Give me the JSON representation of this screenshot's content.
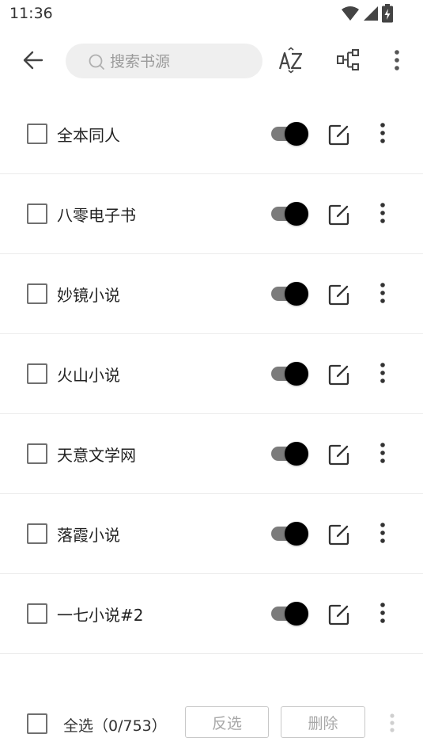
{
  "status_bar": {
    "time": "11:36",
    "icons": [
      "wifi-icon",
      "signal-icon",
      "battery-charging-icon"
    ]
  },
  "toolbar": {
    "back_icon": "arrow-left-icon",
    "search_placeholder": "搜索书源",
    "search_value": "",
    "sort_icon": "sort-az-icon",
    "group_icon": "group-tree-icon",
    "more_icon": "more-vert-icon"
  },
  "sources": [
    {
      "name": "全本同人",
      "enabled": true,
      "checked": false
    },
    {
      "name": "八零电子书",
      "enabled": true,
      "checked": false
    },
    {
      "name": "妙镜小说",
      "enabled": true,
      "checked": false
    },
    {
      "name": "火山小说",
      "enabled": true,
      "checked": false
    },
    {
      "name": "天意文学网",
      "enabled": true,
      "checked": false
    },
    {
      "name": "落霞小说",
      "enabled": true,
      "checked": false
    },
    {
      "name": "一七小说#2",
      "enabled": true,
      "checked": false
    }
  ],
  "bottom_bar": {
    "select_all_label": "全选（0/753）",
    "invert_label": "反选",
    "delete_label": "删除"
  },
  "colors": {
    "switch_thumb": "#000000",
    "switch_track": "#7b7b7b",
    "disabled_text": "#a8a8a8"
  }
}
